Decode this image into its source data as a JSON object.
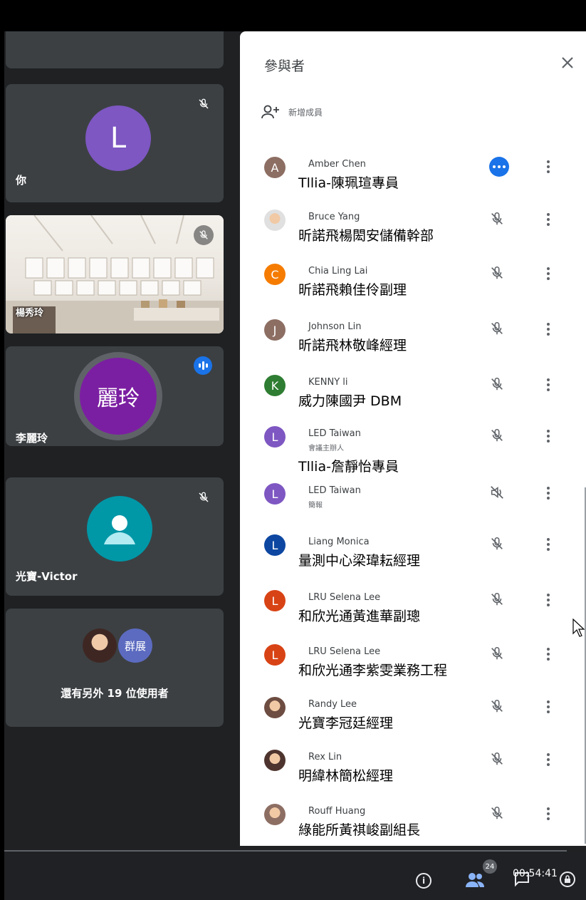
{
  "left": {
    "self_tile": {
      "initial": "L",
      "name": "你"
    },
    "video_tile": {
      "overlay_name": "楊秀玲"
    },
    "speaker_tile": {
      "avatar_text": "麗玲",
      "name": "李麗玲"
    },
    "victor_tile": {
      "name": "光寶-Victor"
    },
    "others_tile": {
      "badge_text": "群展",
      "label": "還有另外 19 位使用者"
    }
  },
  "panel": {
    "title": "參與者",
    "add_member": "新增成員",
    "participants": [
      {
        "initial": "A",
        "color": "#8d6e63",
        "name": "Amber Chen",
        "sub": "",
        "caption": "Tllia-陳珮瑄專員",
        "status": "more"
      },
      {
        "initial": "",
        "color": "#e0e0e0",
        "name": "Bruce Yang",
        "sub": "",
        "caption": "昕諾飛楊閎安儲備幹部",
        "status": "muted"
      },
      {
        "initial": "C",
        "color": "#f57c00",
        "name": "Chia Ling Lai",
        "sub": "",
        "caption": "昕諾飛賴佳伶副理",
        "status": "muted"
      },
      {
        "initial": "J",
        "color": "#8d6e63",
        "name": "Johnson Lin",
        "sub": "",
        "caption": "昕諾飛林敬峰經理",
        "status": "muted"
      },
      {
        "initial": "K",
        "color": "#2e7d32",
        "name": "KENNY li",
        "sub": "",
        "caption": "威力陳國尹 DBM",
        "status": "muted"
      },
      {
        "initial": "L",
        "color": "#7e57c2",
        "name": "LED Taiwan",
        "sub": "會議主辦人",
        "caption": "Tllia-詹靜怡專員",
        "status": "muted"
      },
      {
        "initial": "L",
        "color": "#7e57c2",
        "name": "LED Taiwan",
        "sub": "簡報",
        "caption": "",
        "status": "muted-pres"
      },
      {
        "initial": "L",
        "color": "#0d47a1",
        "name": "Liang Monica",
        "sub": "",
        "caption": "量測中心梁瑋耘經理",
        "status": "muted"
      },
      {
        "initial": "L",
        "color": "#d84315",
        "name": "LRU Selena Lee",
        "sub": "",
        "caption": "和欣光通黃進華副璁",
        "status": "muted"
      },
      {
        "initial": "L",
        "color": "#d84315",
        "name": "LRU Selena Lee",
        "sub": "",
        "caption": "和欣光通李紫雯業務工程",
        "status": "muted"
      },
      {
        "initial": "",
        "color": "#6d4c41",
        "name": "Randy Lee",
        "sub": "",
        "caption": "光寶李冠廷經理",
        "status": "muted"
      },
      {
        "initial": "",
        "color": "#4e342e",
        "name": "Rex Lin",
        "sub": "",
        "caption": "明緯林簡松經理",
        "status": "muted"
      },
      {
        "initial": "",
        "color": "#8d6e63",
        "name": "Rouff Huang",
        "sub": "",
        "caption": "綠能所黃祺峻副組長",
        "status": "muted"
      }
    ]
  },
  "bottom": {
    "people_count": "24",
    "time": "00:54:41"
  },
  "colors": {
    "panel_bg": "#ffffff",
    "tile_bg": "#3c4043",
    "accent": "#1a73e8"
  }
}
